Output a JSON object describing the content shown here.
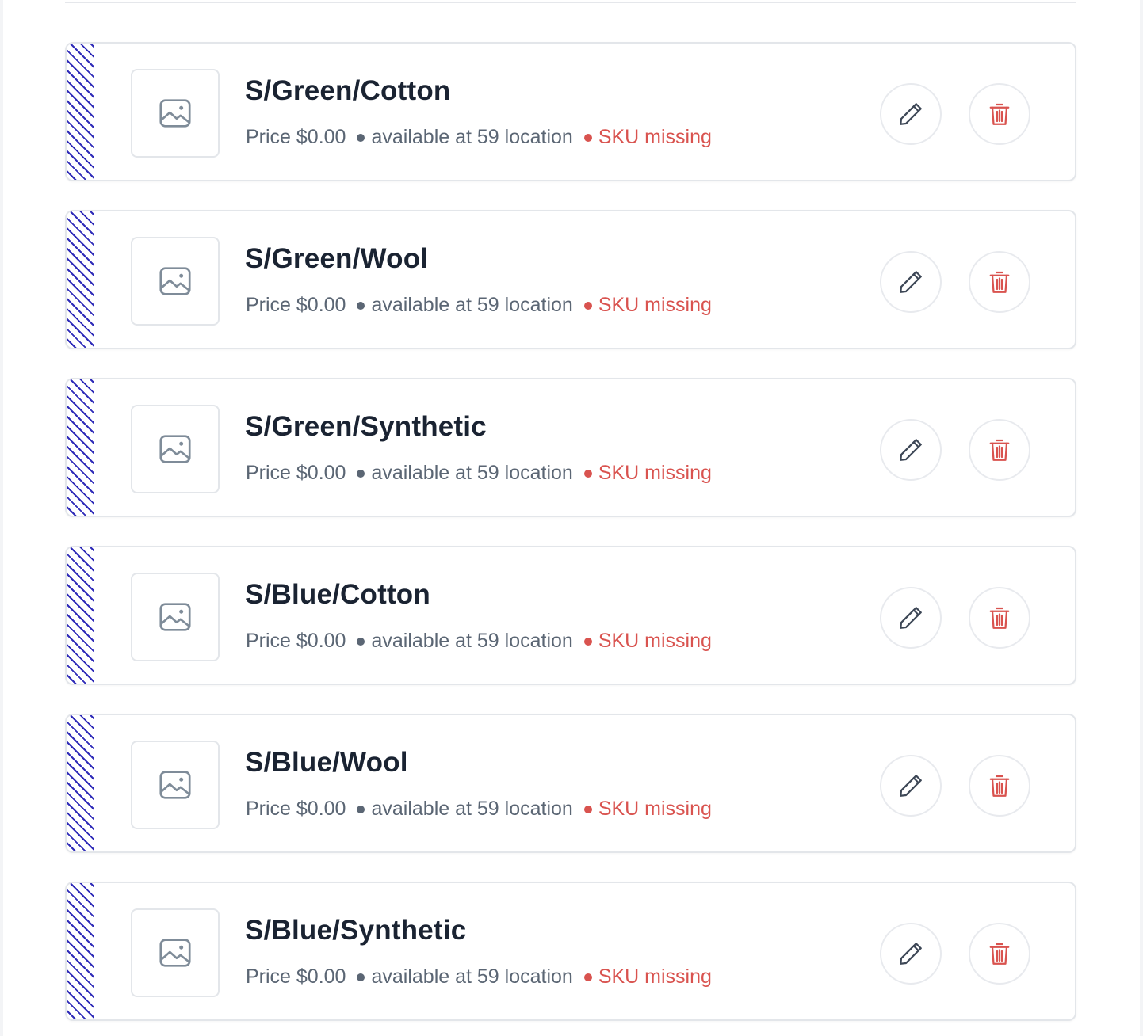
{
  "variants": [
    {
      "title": "S/Green/Cotton",
      "price": "Price $0.00",
      "availability": "available at 59 location",
      "sku_status": "SKU missing"
    },
    {
      "title": "S/Green/Wool",
      "price": "Price $0.00",
      "availability": "available at 59 location",
      "sku_status": "SKU missing"
    },
    {
      "title": "S/Green/Synthetic",
      "price": "Price $0.00",
      "availability": "available at 59 location",
      "sku_status": "SKU missing"
    },
    {
      "title": "S/Blue/Cotton",
      "price": "Price $0.00",
      "availability": "available at 59 location",
      "sku_status": "SKU missing"
    },
    {
      "title": "S/Blue/Wool",
      "price": "Price $0.00",
      "availability": "available at 59 location",
      "sku_status": "SKU missing"
    },
    {
      "title": "S/Blue/Synthetic",
      "price": "Price $0.00",
      "availability": "available at 59 location",
      "sku_status": "SKU missing"
    }
  ],
  "icons": {
    "drag": "drag-handle-icon",
    "thumbnail": "image-placeholder-icon",
    "edit": "pencil-icon",
    "delete": "trash-icon"
  },
  "colors": {
    "title": "#1a2332",
    "meta": "#5b6674",
    "danger": "#d9534f",
    "drag_stripe": "#2f2bb8",
    "border": "#e3e6ea"
  }
}
